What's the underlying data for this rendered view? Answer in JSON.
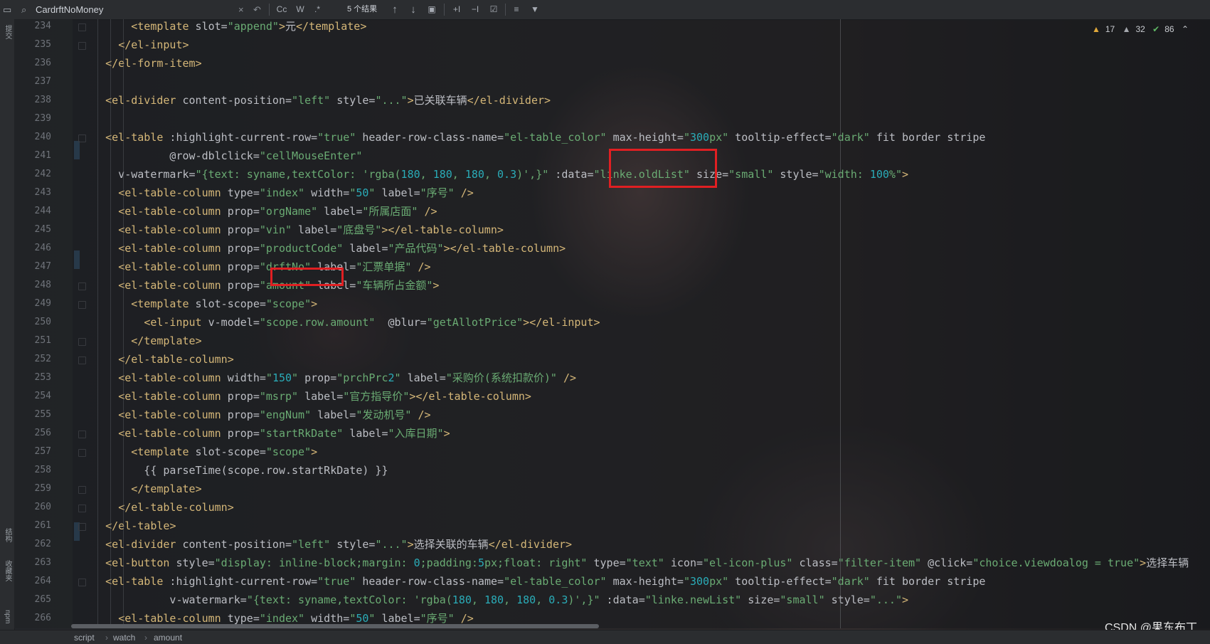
{
  "search": {
    "query": "CardrftNoMoney",
    "result_count": "5 个结果",
    "options": [
      "Cc",
      "W",
      ".*"
    ]
  },
  "left_strip": {
    "top_label": "提交",
    "mid_label": "结构",
    "bottom_label": "收藏夹",
    "npm_label": "npm"
  },
  "inspections": {
    "warnings": "17",
    "weak_warnings": "32",
    "ok": "86"
  },
  "line_numbers": [
    "234",
    "235",
    "236",
    "237",
    "238",
    "239",
    "240",
    "241",
    "242",
    "243",
    "244",
    "245",
    "246",
    "247",
    "248",
    "249",
    "250",
    "251",
    "252",
    "253",
    "254",
    "255",
    "256",
    "257",
    "258",
    "259",
    "260",
    "261",
    "262",
    "263",
    "264",
    "265",
    "266"
  ],
  "code_lines": [
    "        <template slot=\"append\">元</template>",
    "      </el-input>",
    "    </el-form-item>",
    "",
    "    <el-divider content-position=\"left\" style=\"...\">已关联车辆</el-divider>",
    "",
    "    <el-table :highlight-current-row=\"true\" header-row-class-name=\"el-table_color\" max-height=\"300px\" tooltip-effect=\"dark\" fit border stripe",
    "              @row-dblclick=\"cellMouseEnter\"",
    "      v-watermark=\"{text: syname,textColor: 'rgba(180, 180, 180, 0.3)',}\" :data=\"linke.oldList\" size=\"small\" style=\"width: 100%\">",
    "      <el-table-column type=\"index\" width=\"50\" label=\"序号\" />",
    "      <el-table-column prop=\"orgName\" label=\"所属店面\" />",
    "      <el-table-column prop=\"vin\" label=\"底盘号\"></el-table-column>",
    "      <el-table-column prop=\"productCode\" label=\"产品代码\"></el-table-column>",
    "      <el-table-column prop=\"drftNo\" label=\"汇票单据\" />",
    "      <el-table-column prop=\"amount\" label=\"车辆所占金额\">",
    "        <template slot-scope=\"scope\">",
    "          <el-input v-model=\"scope.row.amount\"  @blur=\"getAllotPrice\"></el-input>",
    "        </template>",
    "      </el-table-column>",
    "      <el-table-column width=\"150\" prop=\"prchPrc2\" label=\"采购价(系统扣款价)\" />",
    "      <el-table-column prop=\"msrp\" label=\"官方指导价\"></el-table-column>",
    "      <el-table-column prop=\"engNum\" label=\"发动机号\" />",
    "      <el-table-column prop=\"startRkDate\" label=\"入库日期\">",
    "        <template slot-scope=\"scope\">",
    "          {{ parseTime(scope.row.startRkDate) }}",
    "        </template>",
    "      </el-table-column>",
    "    </el-table>",
    "    <el-divider content-position=\"left\" style=\"...\">选择关联的车辆</el-divider>",
    "    <el-button style=\"display: inline-block;margin: 0;padding:5px;float: right\" type=\"text\" icon=\"el-icon-plus\" class=\"filter-item\" @click=\"choice.viewdoalog = true\">选择车辆",
    "    <el-table :highlight-current-row=\"true\" header-row-class-name=\"el-table_color\" max-height=\"300px\" tooltip-effect=\"dark\" fit border stripe",
    "              v-watermark=\"{text: syname,textColor: 'rgba(180, 180, 180, 0.3)',}\" :data=\"linke.newList\" size=\"small\" style=\"...\">",
    "      <el-table-column type=\"index\" width=\"50\" label=\"序号\" />",
    "      <el-table-column prop=\"orgName\" label=\"所属店面\" />"
  ],
  "breadcrumbs": [
    "script",
    "watch",
    "amount"
  ],
  "watermark": "CSDN @果东布丁",
  "colors": {
    "tag": "#d5b778",
    "string": "#6aab73",
    "number": "#2aacb8",
    "keyword": "#cf8e6d",
    "highlight_box": "#e01f22"
  }
}
